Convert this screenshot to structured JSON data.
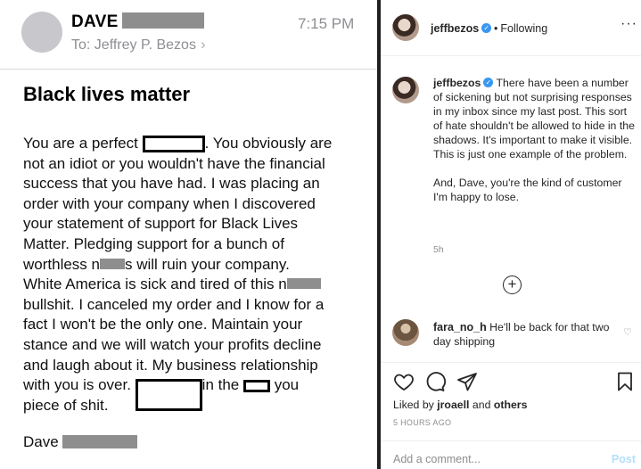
{
  "email": {
    "sender_name": "DAVE",
    "time": "7:15 PM",
    "to_label": "To:",
    "to_name": "Jeffrey P. Bezos",
    "subject": "Black lives matter",
    "body_lines": [
      [
        "You are a perfect ",
        "[BOX]",
        ". You obviously are"
      ],
      [
        "not an idiot or you wouldn't have the financial"
      ],
      [
        "success that you have had. I was placing an"
      ],
      [
        "order with your company when I discovered"
      ],
      [
        "your statement of support for Black Lives"
      ],
      [
        "Matter. Pledging support for a bunch of"
      ],
      [
        "worthless n",
        "[GRAY]",
        "s will ruin your company."
      ],
      [
        "White America is sick and tired of this n",
        "[GRAY]"
      ],
      [
        "bullshit. I canceled my order and I know for a"
      ],
      [
        "fact I won't be the only one. Maintain your"
      ],
      [
        "stance and we will watch your profits decline"
      ],
      [
        "and laugh about it. My business relationship"
      ],
      [
        "with you is over. ",
        "[BOX]",
        "in the ",
        "[BOX]",
        " you"
      ],
      [
        "piece of shit."
      ]
    ],
    "signoff": "Dave"
  },
  "instagram": {
    "username": "jeffbezos",
    "following": "Following",
    "caption_p1": "There have been a number of sickening but not surprising responses in my inbox since my last post. This sort of hate shouldn't be allowed to hide in the shadows. It's important to make it visible. This is just one example of the problem.",
    "caption_p2": "And, Dave, you're the kind of customer I'm happy to lose.",
    "caption_time": "5h",
    "comment": {
      "username": "fara_no_h",
      "text": "He'll be back for that two day shipping"
    },
    "likes_prefix": "Liked by",
    "likes_user": "jroaell",
    "likes_and": "and",
    "likes_others": "others",
    "post_time": "5 HOURS AGO",
    "add_comment_placeholder": "Add a comment...",
    "post_label": "Post"
  },
  "colors": {
    "verified": "#3897f0",
    "post_disabled": "#b2dffc",
    "redaction_gray": "#8e8e8e"
  }
}
